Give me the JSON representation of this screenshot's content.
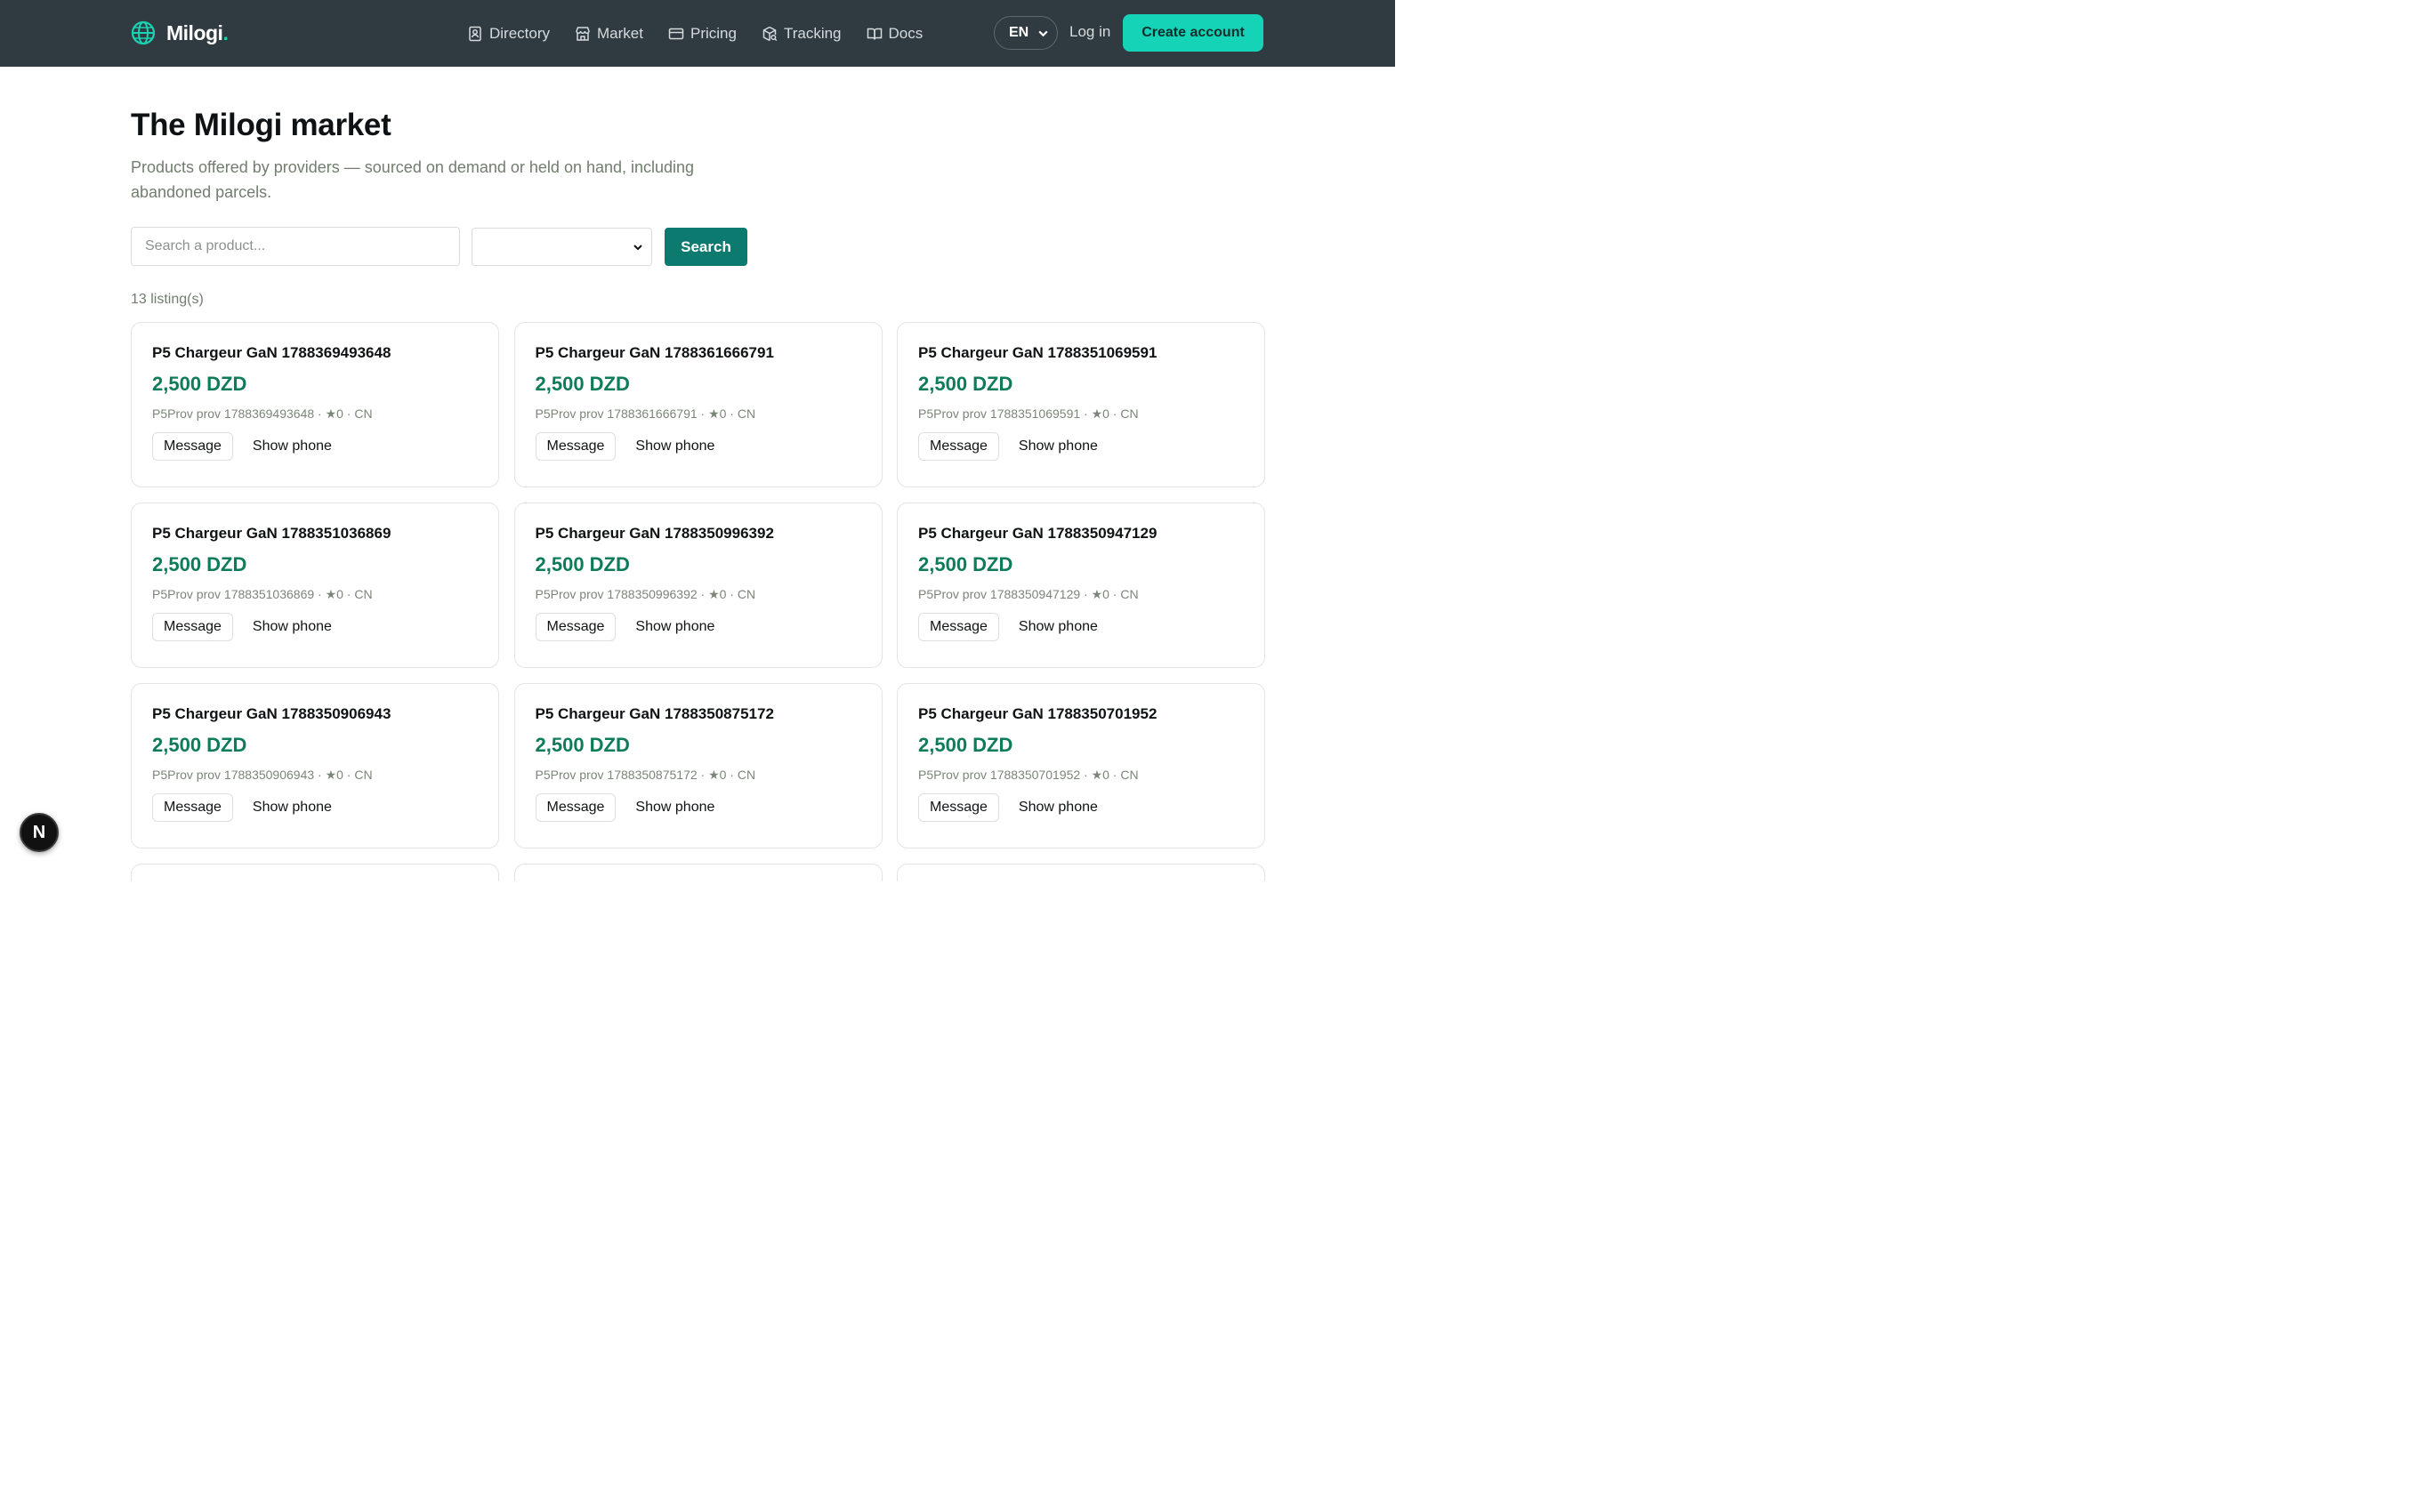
{
  "header": {
    "brand": "Milogi",
    "brand_dot": ".",
    "nav": [
      {
        "label": "Directory",
        "icon": "contact-book-icon"
      },
      {
        "label": "Market",
        "icon": "storefront-icon"
      },
      {
        "label": "Pricing",
        "icon": "credit-card-icon"
      },
      {
        "label": "Tracking",
        "icon": "package-search-icon"
      },
      {
        "label": "Docs",
        "icon": "open-book-icon"
      }
    ],
    "language": "EN",
    "login": "Log in",
    "create_account": "Create account"
  },
  "main": {
    "title": "The Milogi market",
    "subtitle": "Products offered by providers — sourced on demand or held on hand, including abandoned parcels.",
    "search": {
      "placeholder": "Search a product...",
      "value": "",
      "category_value": "",
      "button": "Search"
    },
    "count": "13 listing(s)"
  },
  "listings": [
    {
      "title": "P5 Chargeur GaN 1788369493648",
      "price": "2,500 DZD",
      "meta": "P5Prov prov 1788369493648 · ★0 · CN",
      "message": "Message",
      "phone": "Show phone"
    },
    {
      "title": "P5 Chargeur GaN 1788361666791",
      "price": "2,500 DZD",
      "meta": "P5Prov prov 1788361666791 · ★0 · CN",
      "message": "Message",
      "phone": "Show phone"
    },
    {
      "title": "P5 Chargeur GaN 1788351069591",
      "price": "2,500 DZD",
      "meta": "P5Prov prov 1788351069591 · ★0 · CN",
      "message": "Message",
      "phone": "Show phone"
    },
    {
      "title": "P5 Chargeur GaN 1788351036869",
      "price": "2,500 DZD",
      "meta": "P5Prov prov 1788351036869 · ★0 · CN",
      "message": "Message",
      "phone": "Show phone"
    },
    {
      "title": "P5 Chargeur GaN 1788350996392",
      "price": "2,500 DZD",
      "meta": "P5Prov prov 1788350996392 · ★0 · CN",
      "message": "Message",
      "phone": "Show phone"
    },
    {
      "title": "P5 Chargeur GaN 1788350947129",
      "price": "2,500 DZD",
      "meta": "P5Prov prov 1788350947129 · ★0 · CN",
      "message": "Message",
      "phone": "Show phone"
    },
    {
      "title": "P5 Chargeur GaN 1788350906943",
      "price": "2,500 DZD",
      "meta": "P5Prov prov 1788350906943 · ★0 · CN",
      "message": "Message",
      "phone": "Show phone"
    },
    {
      "title": "P5 Chargeur GaN 1788350875172",
      "price": "2,500 DZD",
      "meta": "P5Prov prov 1788350875172 · ★0 · CN",
      "message": "Message",
      "phone": "Show phone"
    },
    {
      "title": "P5 Chargeur GaN 1788350701952",
      "price": "2,500 DZD",
      "meta": "P5Prov prov 1788350701952 · ★0 · CN",
      "message": "Message",
      "phone": "Show phone"
    }
  ],
  "dev_badge": "N",
  "colors": {
    "header_bg": "#2f3b40",
    "accent": "#14d3b7",
    "primary_button": "#0c7a6e",
    "price": "#0e7c5a"
  }
}
